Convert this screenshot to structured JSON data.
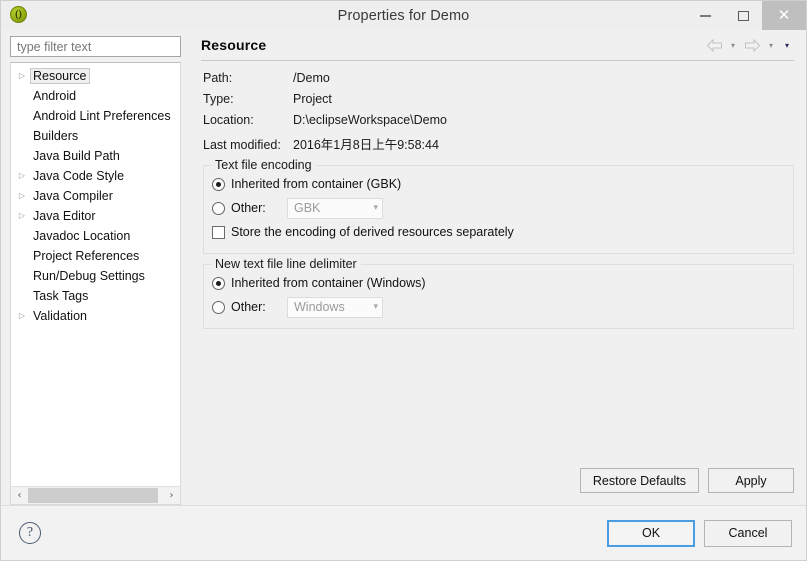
{
  "window": {
    "title": "Properties for Demo",
    "app_icon": "eclipse-project-icon",
    "minimize_label": "Minimize",
    "maximize_label": "Maximize",
    "close_label": "Close"
  },
  "filter": {
    "placeholder": "type filter text",
    "value": ""
  },
  "tree": {
    "items": [
      {
        "label": "Resource",
        "expandable": true,
        "selected": true
      },
      {
        "label": "Android",
        "expandable": false,
        "selected": false
      },
      {
        "label": "Android Lint Preferences",
        "expandable": false,
        "selected": false
      },
      {
        "label": "Builders",
        "expandable": false,
        "selected": false
      },
      {
        "label": "Java Build Path",
        "expandable": false,
        "selected": false
      },
      {
        "label": "Java Code Style",
        "expandable": true,
        "selected": false
      },
      {
        "label": "Java Compiler",
        "expandable": true,
        "selected": false
      },
      {
        "label": "Java Editor",
        "expandable": true,
        "selected": false
      },
      {
        "label": "Javadoc Location",
        "expandable": false,
        "selected": false
      },
      {
        "label": "Project References",
        "expandable": false,
        "selected": false
      },
      {
        "label": "Run/Debug Settings",
        "expandable": false,
        "selected": false
      },
      {
        "label": "Task Tags",
        "expandable": false,
        "selected": false
      },
      {
        "label": "Validation",
        "expandable": true,
        "selected": false
      }
    ],
    "scroll_left_label": "‹",
    "scroll_right_label": "›"
  },
  "page": {
    "title": "Resource",
    "nav": {
      "back_label": "Back",
      "back_menu_label": "▾",
      "forward_label": "Forward",
      "forward_menu_label": "▾",
      "view_menu_label": "▾"
    },
    "properties": [
      {
        "label": "Path:",
        "value": "/Demo"
      },
      {
        "label": "Type:",
        "value": "Project"
      },
      {
        "label": "Location:",
        "value": "D:\\eclipseWorkspace\\Demo"
      },
      {
        "label": "Last modified:",
        "value": "2016年1月8日上午9:58:44"
      }
    ],
    "encoding_group": {
      "title": "Text file encoding",
      "inherited_label": "Inherited from container (GBK)",
      "inherited_selected": true,
      "other_label": "Other:",
      "other_selected": false,
      "other_value": "GBK",
      "other_enabled": false,
      "store_derived_label": "Store the encoding of derived resources separately",
      "store_derived_checked": false
    },
    "delimiter_group": {
      "title": "New text file line delimiter",
      "inherited_label": "Inherited from container (Windows)",
      "inherited_selected": true,
      "other_label": "Other:",
      "other_selected": false,
      "other_value": "Windows",
      "other_enabled": false
    },
    "restore_defaults_label": "Restore Defaults",
    "apply_label": "Apply"
  },
  "footer": {
    "help_label": "?",
    "ok_label": "OK",
    "cancel_label": "Cancel"
  },
  "colors": {
    "window_bg": "#f0f0f0",
    "titlebar_bg": "#eeeeee",
    "close_bg": "#bfbfbf",
    "focus_border": "#4a9de0",
    "app_icon": "#96b011",
    "help_icon": "#44556e"
  }
}
